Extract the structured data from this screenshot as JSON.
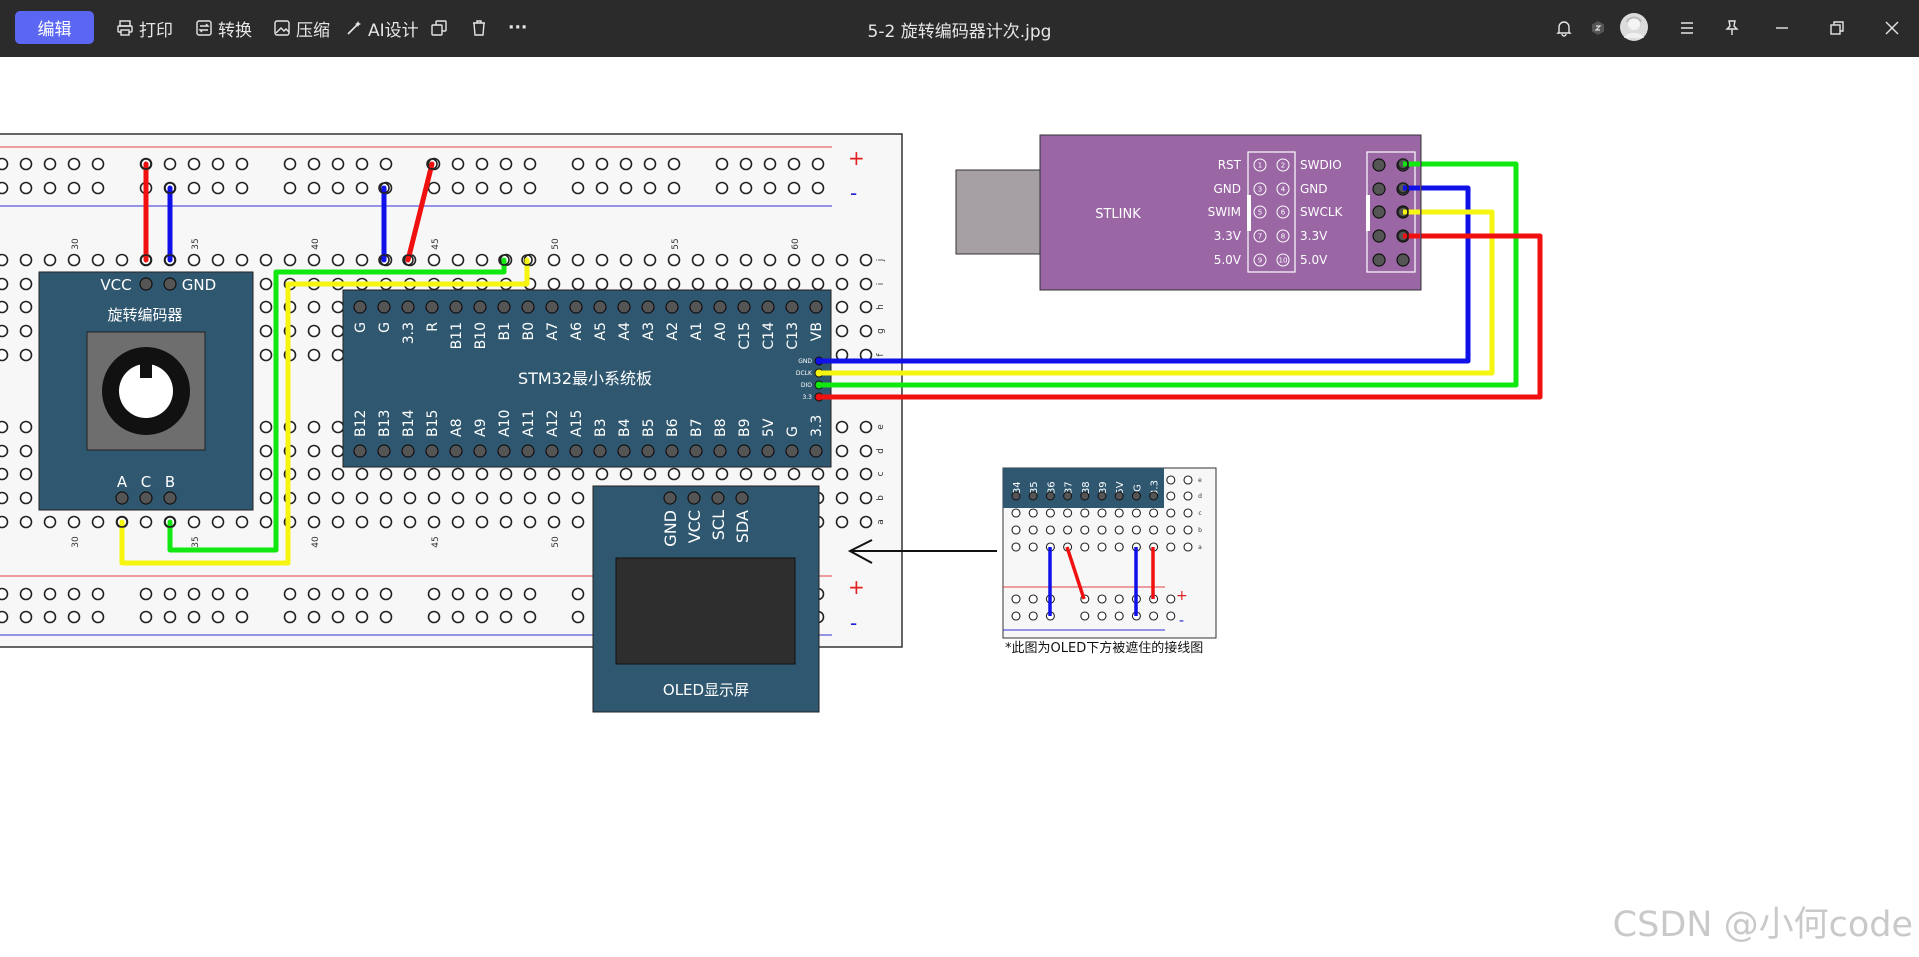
{
  "toolbar": {
    "edit_label": "编辑",
    "print_label": "打印",
    "convert_label": "转换",
    "compress_label": "压缩",
    "ai_design_label": "AI设计",
    "more_label": "···",
    "accent_color": "#5b67f2",
    "bar_color": "#2b2b2b"
  },
  "document": {
    "title": "5-2 旋转编码器计次.jpg"
  },
  "image": {
    "breadboard": {
      "col_labels": [
        "30",
        "35",
        "40",
        "45",
        "50",
        "55",
        "60"
      ],
      "row_labels_top": [
        "j",
        "i",
        "h",
        "g",
        "f"
      ],
      "row_labels_bottom": [
        "e",
        "d",
        "c",
        "b",
        "a"
      ],
      "plus_label": "+",
      "minus_label": "-"
    },
    "encoder": {
      "title": "旋转编码器",
      "vcc": "VCC",
      "gnd": "GND",
      "pin_a": "A",
      "pin_c": "C",
      "pin_b": "B"
    },
    "stm32": {
      "title": "STM32最小系统板",
      "top_pins": [
        "G",
        "G",
        "3.3",
        "R",
        "B11",
        "B10",
        "B1",
        "B0",
        "A7",
        "A6",
        "A5",
        "A4",
        "A3",
        "A2",
        "A1",
        "A0",
        "C15",
        "C14",
        "C13",
        "VB"
      ],
      "bottom_pins": [
        "B12",
        "B13",
        "B14",
        "B15",
        "A8",
        "A9",
        "A10",
        "A11",
        "A12",
        "A15",
        "B3",
        "B4",
        "B5",
        "B6",
        "B7",
        "B8",
        "B9",
        "5V",
        "G",
        "3.3"
      ],
      "debug_pins": [
        "GND",
        "DCLK",
        "DIO",
        "3.3"
      ]
    },
    "oled": {
      "title": "OLED显示屏",
      "pins": [
        "GND",
        "VCC",
        "SCL",
        "SDA"
      ]
    },
    "stlink": {
      "label": "STLINK",
      "left_labels": [
        "RST",
        "GND",
        "SWIM",
        "3.3V",
        "5.0V"
      ],
      "right_labels": [
        "SWDIO",
        "GND",
        "SWCLK",
        "3.3V",
        "5.0V"
      ],
      "pin_numbers": [
        "1",
        "2",
        "3",
        "4",
        "5",
        "6",
        "7",
        "8",
        "9",
        "10"
      ]
    },
    "inset": {
      "pins": [
        "B4",
        "B5",
        "B6",
        "B7",
        "B8",
        "B9",
        "5V",
        "G",
        "3.3"
      ],
      "row_labels": [
        "e",
        "d",
        "c",
        "b",
        "a"
      ],
      "caption": "*此图为OLED下方被遮住的接线图",
      "plus_label": "+",
      "minus_label": "-"
    },
    "wire_colors": {
      "red": "#f01010",
      "blue": "#1010e8",
      "green": "#10e810",
      "yellow": "#f5f510"
    }
  },
  "watermark": "CSDN @小何code"
}
